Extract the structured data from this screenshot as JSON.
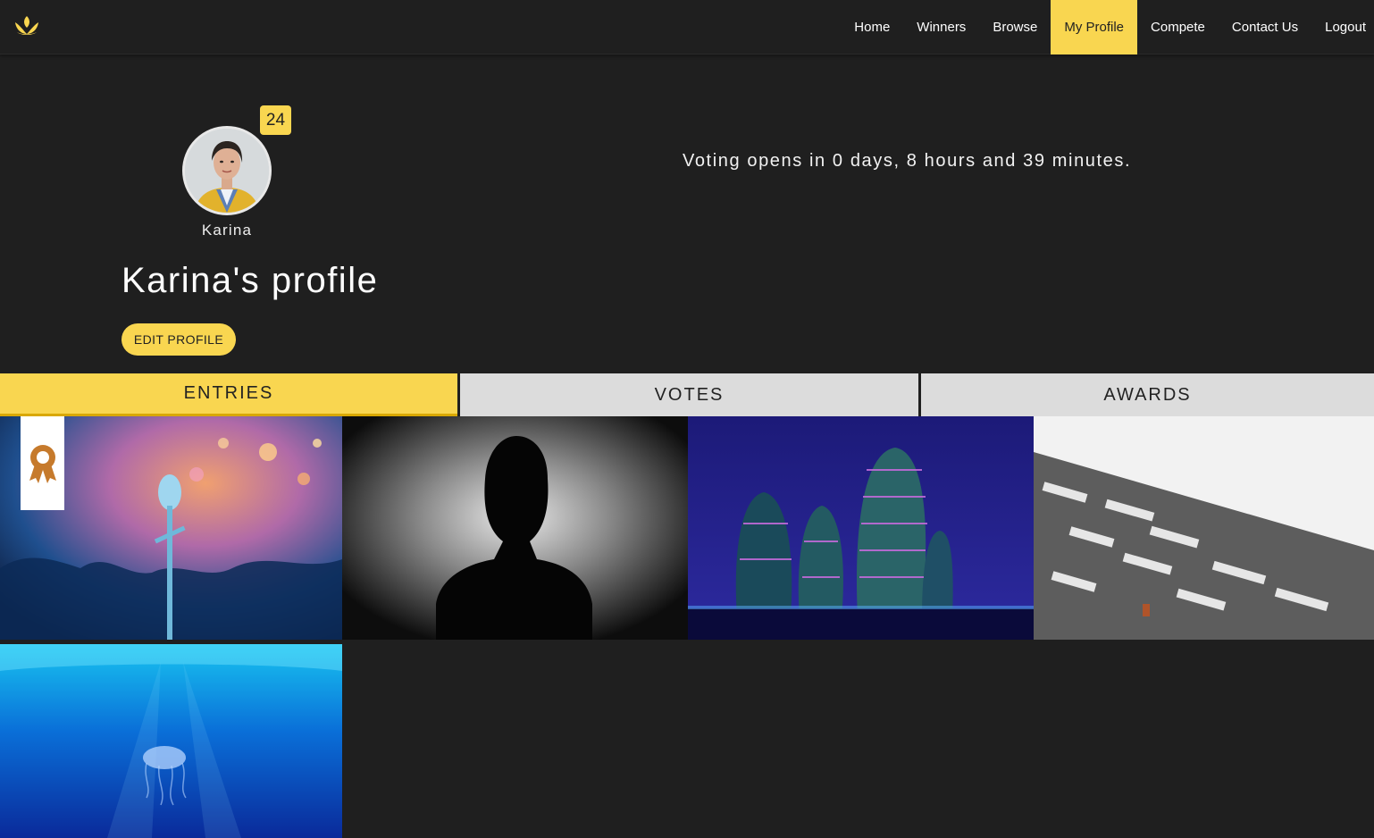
{
  "nav": {
    "logo_icon": "lotus-logo-icon",
    "items": [
      {
        "label": "Home"
      },
      {
        "label": "Winners"
      },
      {
        "label": "Browse"
      },
      {
        "label": "My Profile",
        "active": true
      },
      {
        "label": "Compete"
      },
      {
        "label": "Contact Us"
      },
      {
        "label": "Logout"
      }
    ]
  },
  "profile": {
    "avatar_badge": "24",
    "avatar_name": "Karina",
    "title": "Karina's profile",
    "edit_label": "EDIT PROFILE"
  },
  "voting": {
    "text": "Voting opens in 0 days, 8 hours and 39 minutes."
  },
  "tabs": [
    {
      "label": "ENTRIES",
      "active": true
    },
    {
      "label": "VOTES"
    },
    {
      "label": "AWARDS"
    }
  ],
  "entries": [
    {
      "photo": "concert-microphone-photo",
      "award_icon": "award-ribbon-icon"
    },
    {
      "photo": "silhouette-portrait-photo"
    },
    {
      "photo": "night-skyscrapers-photo"
    },
    {
      "photo": "building-facade-photo"
    },
    {
      "photo": "jellyfish-underwater-photo"
    }
  ],
  "colors": {
    "accent": "#f9d650",
    "background": "#1f1f1f",
    "tab_inactive": "#dcdcdc",
    "award": "#c67a2c"
  }
}
